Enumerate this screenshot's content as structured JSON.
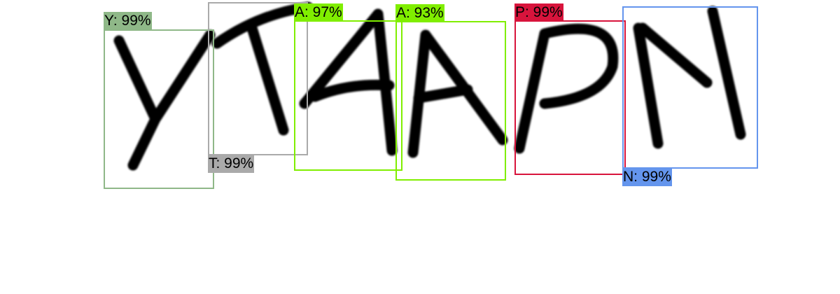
{
  "detections": [
    {
      "id": "y",
      "text": "Y: 99%",
      "character": "Y",
      "confidence": 99,
      "color": "#8fb888"
    },
    {
      "id": "t",
      "text": "T: 99%",
      "character": "T",
      "confidence": 99,
      "color": "#aaaaaa"
    },
    {
      "id": "a1",
      "text": "A: 97%",
      "character": "A",
      "confidence": 97,
      "color": "#80ee00"
    },
    {
      "id": "a2",
      "text": "A: 93%",
      "character": "A",
      "confidence": 93,
      "color": "#80ee00"
    },
    {
      "id": "p",
      "text": "P: 99%",
      "character": "P",
      "confidence": 99,
      "color": "#d8143c"
    },
    {
      "id": "n",
      "text": "N: 99%",
      "character": "N",
      "confidence": 99,
      "color": "#6495ed"
    }
  ]
}
